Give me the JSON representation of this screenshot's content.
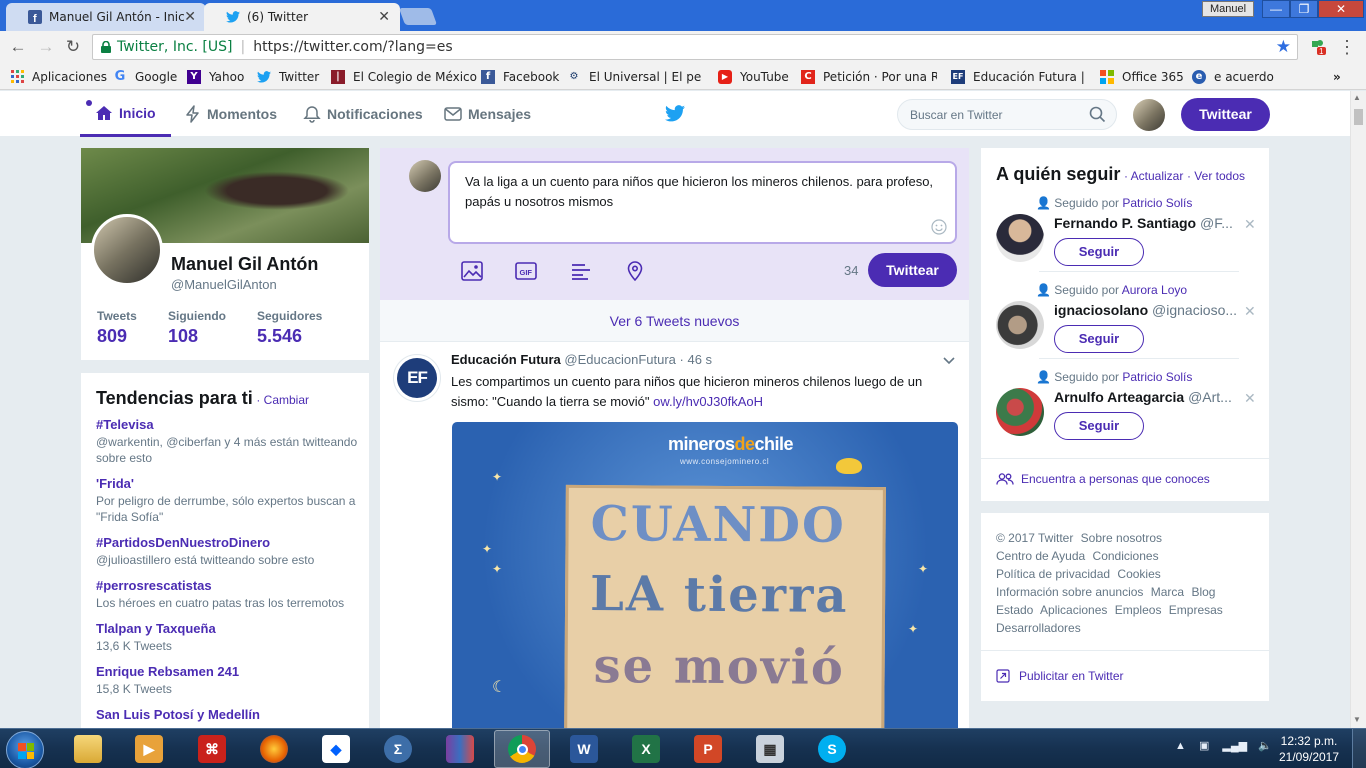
{
  "browser": {
    "tabs": [
      {
        "label": "Manuel Gil Antón - Inicio",
        "icon": "facebook-icon"
      },
      {
        "label": "(6) Twitter",
        "icon": "twitter-icon"
      }
    ],
    "window_user": "Manuel",
    "address": {
      "secure_label": "Twitter, Inc. [US]",
      "url": "https://twitter.com/?lang=es"
    },
    "extension_badge": "1",
    "bookmarks": [
      {
        "label": "Aplicaciones",
        "icon": "apps-grid-icon"
      },
      {
        "label": "Google",
        "icon": "google-icon"
      },
      {
        "label": "Yahoo",
        "icon": "yahoo-icon"
      },
      {
        "label": "Twitter",
        "icon": "twitter-icon"
      },
      {
        "label": "El Colegio de México",
        "icon": "colmex-icon"
      },
      {
        "label": "Facebook",
        "icon": "facebook-icon"
      },
      {
        "label": "El Universal | El periódi",
        "icon": "universal-icon"
      },
      {
        "label": "YouTube",
        "icon": "youtube-icon"
      },
      {
        "label": "Petición · Por una Ref",
        "icon": "change-org-icon"
      },
      {
        "label": "Educación Futura | Pe",
        "icon": "ef-icon"
      },
      {
        "label": "Office 365",
        "icon": "office-icon"
      },
      {
        "label": "e acuerdo",
        "icon": "bookmark-icon"
      }
    ]
  },
  "twitter": {
    "nav": {
      "home": "Inicio",
      "moments": "Momentos",
      "notifications": "Notificaciones",
      "messages": "Mensajes",
      "search_placeholder": "Buscar en Twitter",
      "tweet_button": "Twittear"
    },
    "profile": {
      "name": "Manuel Gil Antón",
      "handle": "@ManuelGilAnton",
      "stats": [
        {
          "label": "Tweets",
          "value": "809"
        },
        {
          "label": "Siguiendo",
          "value": "108"
        },
        {
          "label": "Seguidores",
          "value": "5.546"
        }
      ]
    },
    "trends": {
      "title": "Tendencias para ti",
      "change_link": "· Cambiar",
      "items": [
        {
          "name": "#Televisa",
          "desc": "@warkentin, @ciberfan y 4 más están twitteando sobre esto"
        },
        {
          "name": "'Frida'",
          "desc": "Por peligro de derrumbe, sólo expertos buscan a \"Frida Sofía\""
        },
        {
          "name": "#PartidosDenNuestroDinero",
          "desc": "@julioastillero está twitteando sobre esto"
        },
        {
          "name": "#perrosrescatistas",
          "desc": "Los héroes en cuatro patas tras los terremotos"
        },
        {
          "name": "Tlalpan y Taxqueña",
          "desc": "13,6 K Tweets"
        },
        {
          "name": "Enrique Rebsamen 241",
          "desc": "15,8 K Tweets"
        },
        {
          "name": "San Luis Potosí y Medellín",
          "desc": ""
        }
      ]
    },
    "composer": {
      "text": "Va la liga a un cuento para niños que hicieron los mineros chilenos. para profeso, papás u nosotros mismos",
      "char_count": "34",
      "button": "Twittear"
    },
    "new_tweets_bar": "Ver 6 Tweets nuevos",
    "tweet": {
      "avatar_text": "EF",
      "name": "Educación Futura",
      "handle": "@EducacionFutura",
      "time": "· 46 s",
      "text": "Les compartimos un cuento para niños que hicieron mineros chilenos luego de un sismo: \"Cuando la tierra se movió\"",
      "link": "ow.ly/hv0J30fkAoH",
      "media": {
        "brand_prefix": "mineros",
        "brand_accent": "de",
        "brand_suffix": "chile",
        "site": "www.consejominero.cl",
        "line1": "CUANDO",
        "line2": "LA tierra",
        "line3": "se movió"
      }
    },
    "who_to_follow": {
      "title": "A quién seguir",
      "refresh": "· Actualizar",
      "view_all": "· Ver todos",
      "suggestions": [
        {
          "context": "Seguido por",
          "by": "Patricio Solís",
          "name": "Fernando P. Santiago",
          "handle": "@F...",
          "button": "Seguir"
        },
        {
          "context": "Seguido por",
          "by": "Aurora Loyo",
          "name": "ignaciosolano",
          "handle": "@ignacioso...",
          "button": "Seguir"
        },
        {
          "context": "Seguido por",
          "by": "Patricio Solís",
          "name": "Arnulfo Arteagarcia",
          "handle": "@Art...",
          "button": "Seguir"
        }
      ],
      "find_people": "Encuentra a personas que conoces"
    },
    "footer": {
      "links": [
        "© 2017 Twitter",
        "Sobre nosotros",
        "Centro de Ayuda",
        "Condiciones",
        "Política de privacidad",
        "Cookies",
        "Información sobre anuncios",
        "Marca",
        "Blog",
        "Estado",
        "Aplicaciones",
        "Empleos",
        "Empresas",
        "Desarrolladores"
      ],
      "ads_link": "Publicitar en Twitter"
    }
  },
  "taskbar": {
    "time": "12:32 p.m.",
    "date": "21/09/2017",
    "apps": [
      "file-explorer-icon",
      "media-player-icon",
      "acrobat-icon",
      "firefox-icon",
      "dropbox-icon",
      "math-input-icon",
      "winrar-icon",
      "chrome-icon",
      "word-icon",
      "excel-icon",
      "powerpoint-icon",
      "calculator-icon",
      "skype-icon"
    ]
  },
  "colors": {
    "accent": "#4b2cb3",
    "chrome_frame": "#2a6bd8",
    "page_bg": "#e6ecf0"
  }
}
